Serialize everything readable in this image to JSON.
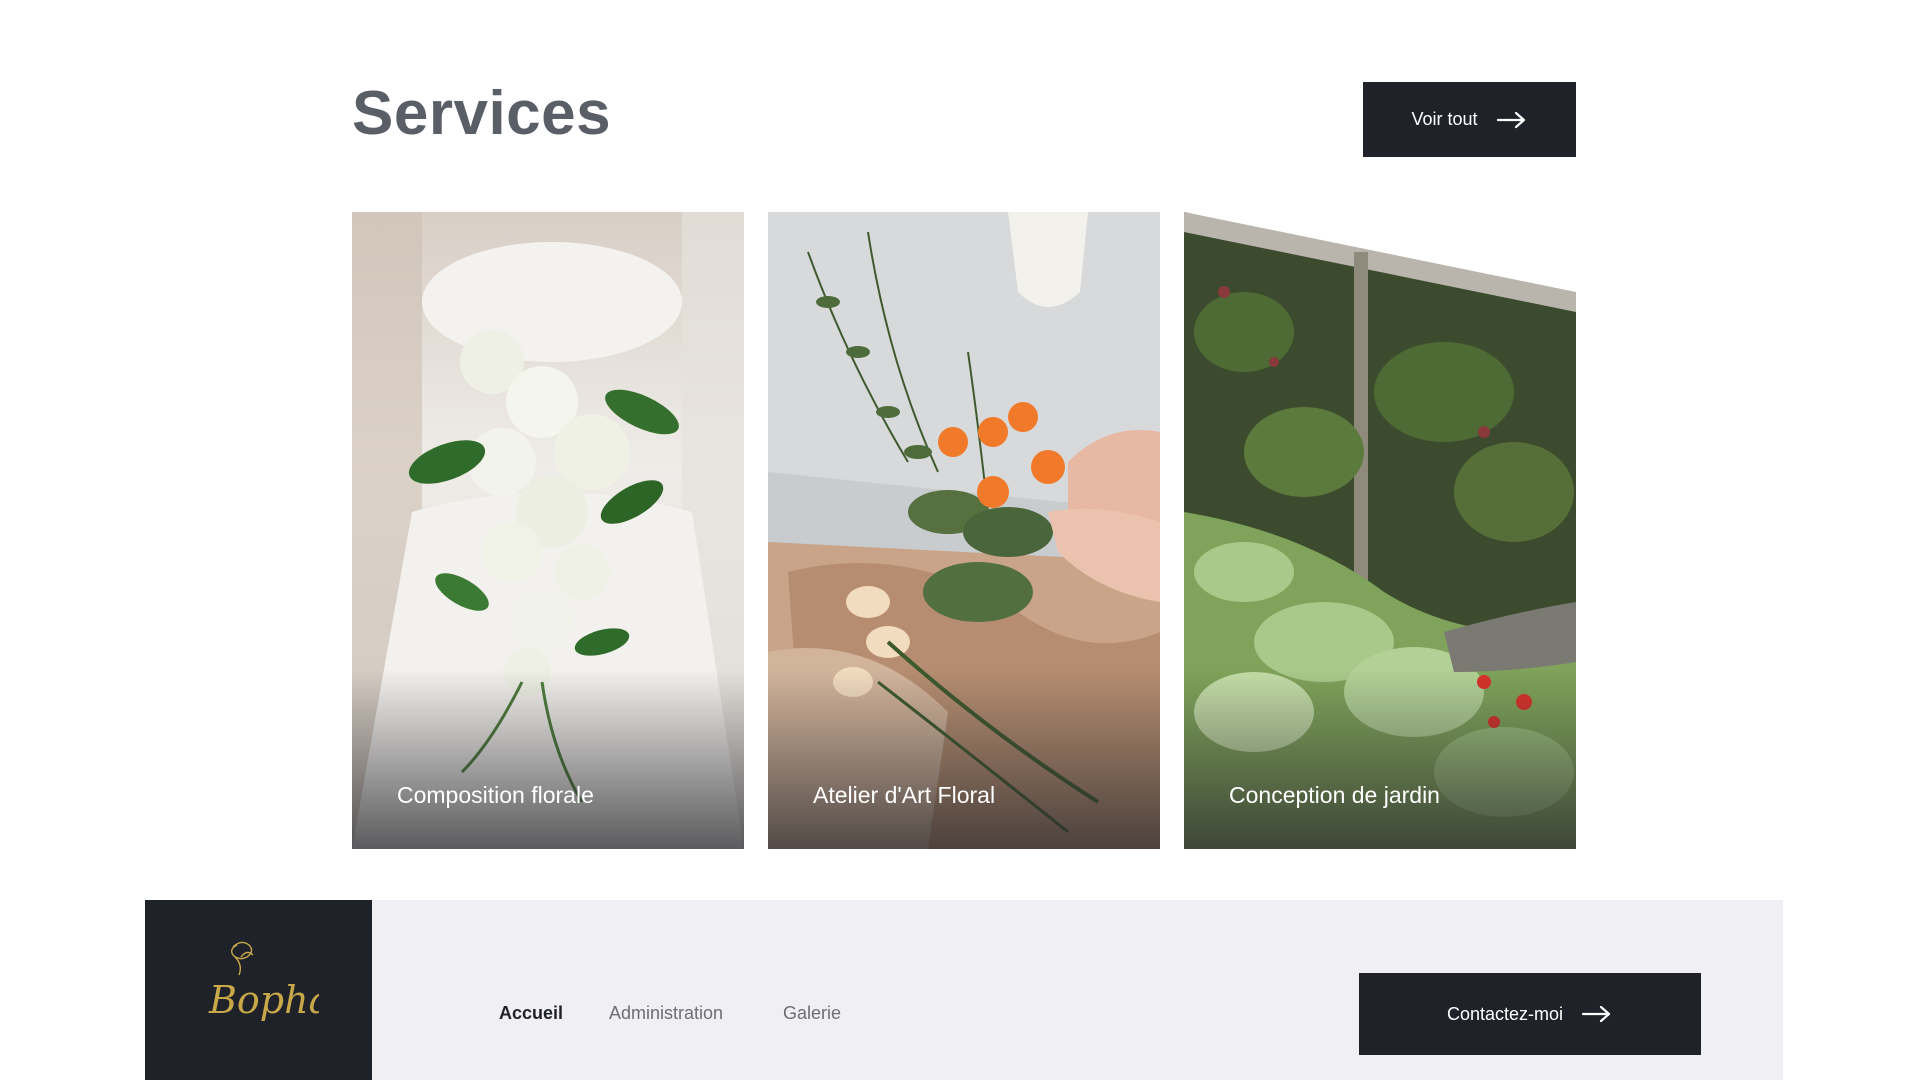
{
  "header": {
    "title": "Services",
    "view_all_label": "Voir tout",
    "view_all_icon": "arrow-right-icon"
  },
  "services": [
    {
      "label": "Composition florale"
    },
    {
      "label": "Atelier d'Art Floral"
    },
    {
      "label": "Conception de jardin"
    }
  ],
  "footer": {
    "logo_text": "Bopha",
    "logo_icon": "rose-icon",
    "nav": [
      {
        "label": "Accueil",
        "active": true
      },
      {
        "label": "Administration",
        "active": false
      },
      {
        "label": "Galerie",
        "active": false
      }
    ],
    "contact_label": "Contactez-moi",
    "contact_icon": "arrow-right-icon"
  },
  "colors": {
    "dark": "#1f2228",
    "title_gray": "#5a5e66",
    "footer_bg": "#f0eff3",
    "logo_gold": "#c9a84a"
  }
}
